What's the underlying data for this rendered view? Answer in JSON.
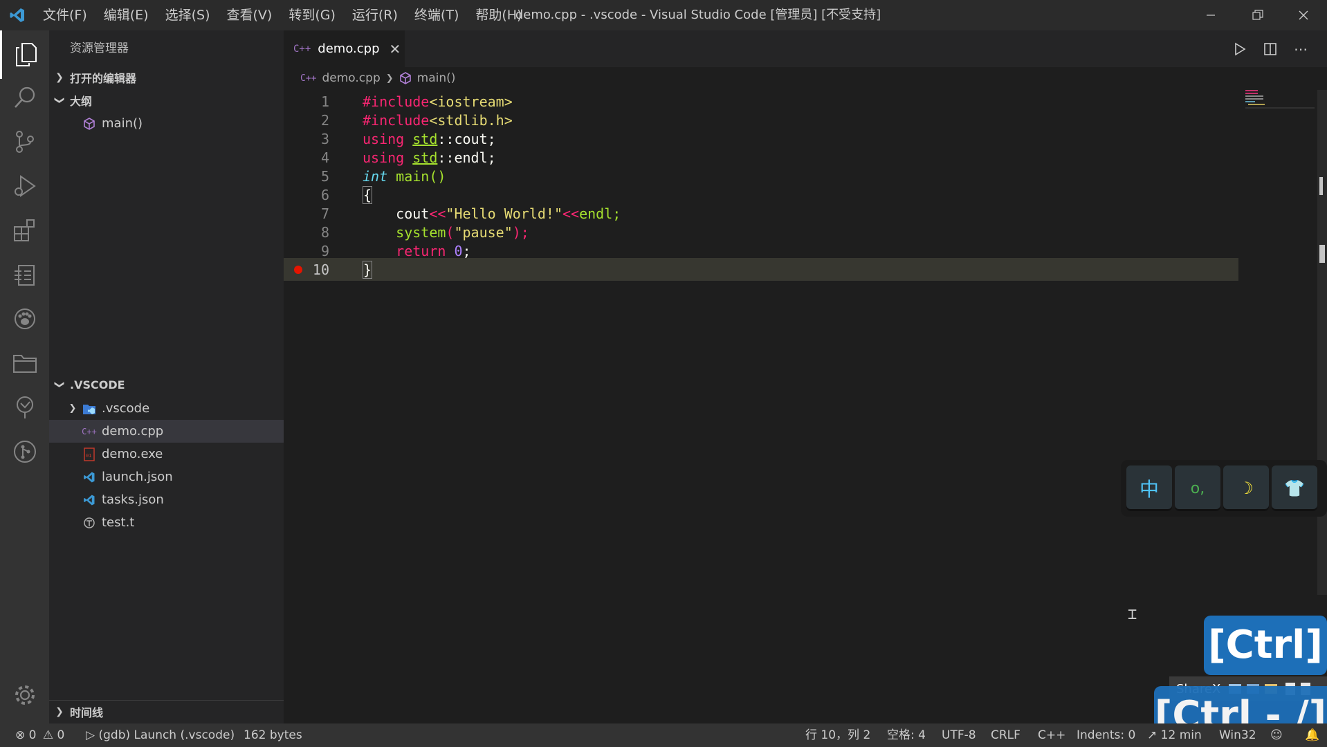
{
  "titlebar": {
    "menu": [
      "文件(F)",
      "编辑(E)",
      "选择(S)",
      "查看(V)",
      "转到(G)",
      "运行(R)",
      "终端(T)",
      "帮助(H)"
    ],
    "title": "demo.cpp - .vscode - Visual Studio Code [管理员] [不受支持]"
  },
  "sidebar": {
    "title": "资源管理器",
    "open_editors": "打开的编辑器",
    "outline": "大纲",
    "outline_items": [
      "main()"
    ],
    "folder": ".VSCODE",
    "files": [
      ".vscode",
      "demo.cpp",
      "demo.exe",
      "launch.json",
      "tasks.json",
      "test.t"
    ],
    "timeline": "时间线"
  },
  "editor": {
    "tab_label": "demo.cpp",
    "tab_lang_badge": "C++",
    "breadcrumb_file": "demo.cpp",
    "breadcrumb_symbol": "main()",
    "line_numbers": [
      "1",
      "2",
      "3",
      "4",
      "5",
      "6",
      "7",
      "8",
      "9",
      "10"
    ]
  },
  "code": {
    "l1_a": "#include",
    "l1_b": "<iostream>",
    "l2_a": "#include",
    "l2_b": "<stdlib.h>",
    "l3_a": "using ",
    "l3_b": "std",
    "l3_c": "::cout;",
    "l4_a": "using ",
    "l4_b": "std",
    "l4_c": "::endl;",
    "l5_a": "int",
    "l5_b": " main()",
    "l6_a": "{",
    "l7_a": "    cout",
    "l7_b": "<<",
    "l7_c": "\"Hello World!\"",
    "l7_d": "<<",
    "l7_e": "endl;",
    "l8_a": "    system",
    "l8_b": "(",
    "l8_c": "\"pause\"",
    "l8_d": ");",
    "l9_a": "    return ",
    "l9_b": "0",
    "l9_c": ";",
    "l10_a": "}"
  },
  "statusbar": {
    "errors": "0",
    "warnings": "0",
    "launch": "(gdb) Launch (.vscode)",
    "size": "162 bytes",
    "position": "行 10，列 2",
    "spaces": "空格: 4",
    "encoding": "UTF-8",
    "eol": "CRLF",
    "language": "C++",
    "indents": "Indents: 0",
    "time": "12 min",
    "platform": "Win32"
  },
  "ime": {
    "key1": "中",
    "key2": "o,",
    "key3": "☽",
    "key4": "👕"
  },
  "overlays": {
    "ctrl": "[Ctrl]",
    "sharex": "ShareX",
    "ctrl_slash": "[Ctrl - /]"
  },
  "colors": {
    "accent": "#007acc",
    "statusbar": "#333333",
    "breakpoint": "#e51400"
  }
}
